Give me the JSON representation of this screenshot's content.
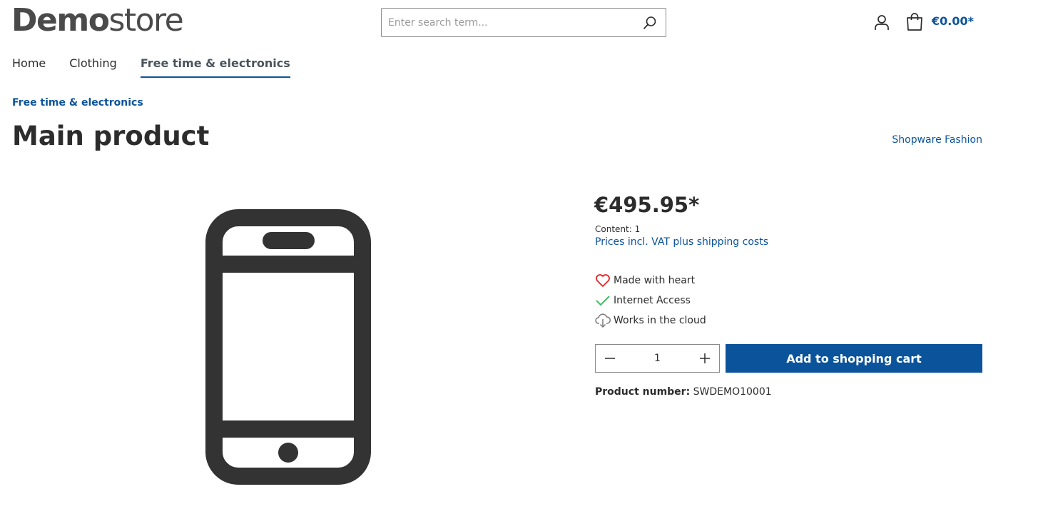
{
  "header": {
    "logo_bold": "Demo",
    "logo_light": "store",
    "search_placeholder": "Enter search term...",
    "cart_total": "€0.00*"
  },
  "nav": {
    "items": [
      {
        "label": "Home"
      },
      {
        "label": "Clothing"
      },
      {
        "label": "Free time & electronics",
        "active": true
      }
    ]
  },
  "breadcrumb": "Free time & electronics",
  "product": {
    "title": "Main product",
    "manufacturer": "Shopware Fashion",
    "price": "€495.95*",
    "content": "Content: 1",
    "vat_link": "Prices incl. VAT plus shipping costs",
    "features": [
      {
        "icon": "heart-icon",
        "label": "Made with heart",
        "color": "#e52427"
      },
      {
        "icon": "checkmark-icon",
        "label": "Internet Access",
        "color": "#3cc261"
      },
      {
        "icon": "cloud-download-icon",
        "label": "Works in the cloud",
        "color": "#7a7a7a"
      }
    ],
    "quantity": "1",
    "add_to_cart_label": "Add to shopping cart",
    "product_number_label": "Product number:",
    "product_number": "SWDEMO10001",
    "image_icon": "smartphone-icon"
  },
  "colors": {
    "accent": "#0b539b",
    "text": "#2c2c2c",
    "image": "#333333"
  }
}
